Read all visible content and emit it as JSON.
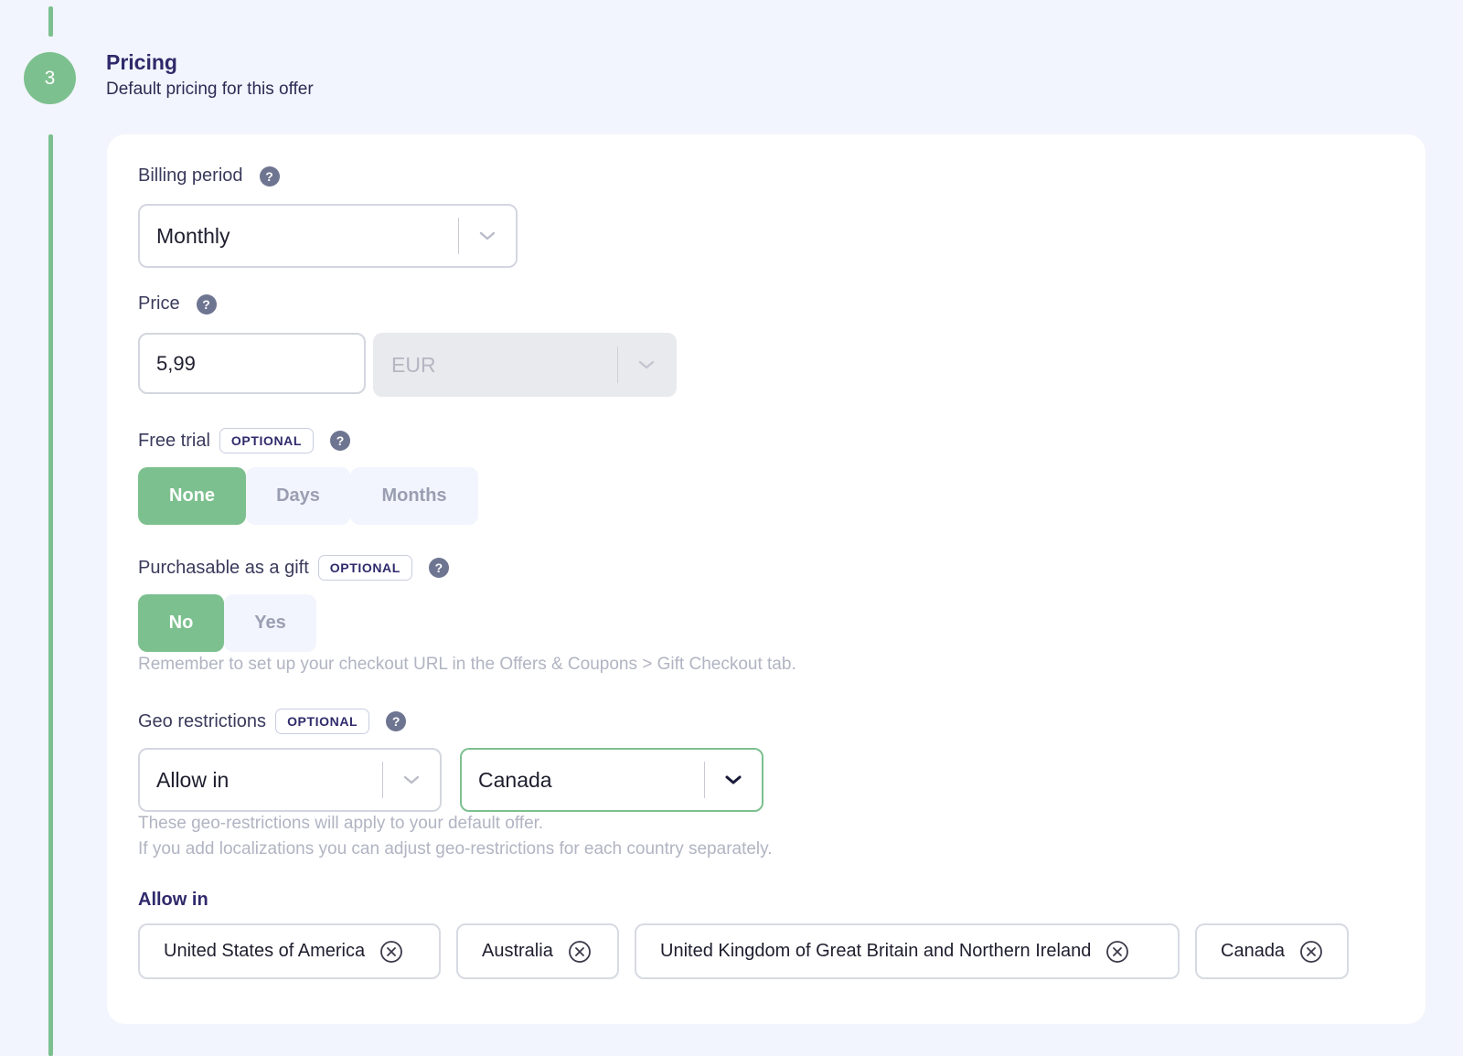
{
  "step": {
    "number": "3",
    "title": "Pricing",
    "subtitle": "Default pricing for this offer"
  },
  "billing": {
    "label": "Billing period",
    "value": "Monthly"
  },
  "price": {
    "label": "Price",
    "value": "5,99",
    "currency": "EUR"
  },
  "free_trial": {
    "label": "Free trial",
    "badge": "OPTIONAL",
    "options": [
      "None",
      "Days",
      "Months"
    ],
    "selected": "None"
  },
  "gift": {
    "label": "Purchasable as a gift",
    "badge": "OPTIONAL",
    "options": [
      "No",
      "Yes"
    ],
    "selected": "No",
    "hint": "Remember to set up your checkout URL in the Offers & Coupons > Gift Checkout tab."
  },
  "geo": {
    "label": "Geo restrictions",
    "badge": "OPTIONAL",
    "mode": "Allow in",
    "country": "Canada",
    "hint_line1": "These geo-restrictions will apply to your default offer.",
    "hint_line2": "If you add localizations you can adjust geo-restrictions for each country separately.",
    "list_label": "Allow in",
    "countries": [
      "United States of America",
      "Australia",
      "United Kingdom of Great Britain and Northern Ireland",
      "Canada"
    ]
  },
  "icons": {
    "help": "help-icon",
    "chevron": "chevron-down-icon",
    "remove": "remove-circle-icon"
  },
  "colors": {
    "accent": "#7dc08f",
    "background": "#f2f5fd",
    "heading": "#2f2a6b",
    "muted_hint": "#b1b4c2"
  }
}
